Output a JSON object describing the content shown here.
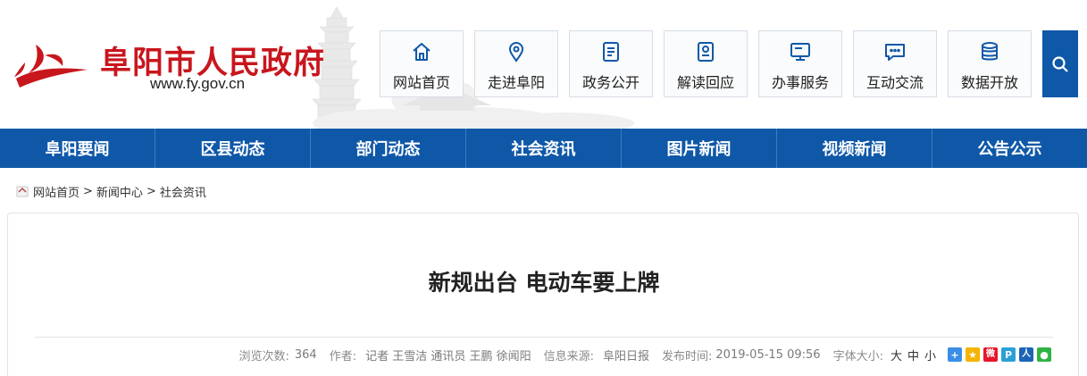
{
  "site": {
    "title": "阜阳市人民政府",
    "url": "www.fy.gov.cn"
  },
  "quick_nav": [
    {
      "label": "网站首页",
      "icon": "home-icon"
    },
    {
      "label": "走进阜阳",
      "icon": "location-pin-icon"
    },
    {
      "label": "政务公开",
      "icon": "document-icon"
    },
    {
      "label": "解读回应",
      "icon": "badge-document-icon"
    },
    {
      "label": "办事服务",
      "icon": "monitor-icon"
    },
    {
      "label": "互动交流",
      "icon": "chat-bubble-icon"
    },
    {
      "label": "数据开放",
      "icon": "database-icon"
    }
  ],
  "search": {
    "icon": "search-icon"
  },
  "main_nav": [
    "阜阳要闻",
    "区县动态",
    "部门动态",
    "社会资讯",
    "图片新闻",
    "视频新闻",
    "公告公示"
  ],
  "breadcrumb": {
    "items": [
      "网站首页",
      "新闻中心",
      "社会资讯"
    ],
    "separator": ">"
  },
  "article": {
    "title": "新规出台 电动车要上牌",
    "meta": {
      "views_label": "浏览次数:",
      "views": "364",
      "author_label": "作者:",
      "author": "记者 王雪洁 通讯员 王鹏 徐闻阳",
      "source_label": "信息来源:",
      "source": "阜阳日报",
      "date_label": "发布时间:",
      "date": "2019-05-15 09:56",
      "fontsize_label": "字体大小:",
      "fontsizes": [
        "大",
        "中",
        "小"
      ]
    },
    "share": [
      {
        "icon": "share-plus-icon",
        "color": "#3a8ee6",
        "glyph": "+"
      },
      {
        "icon": "qzone-icon",
        "color": "#f5b400",
        "glyph": "★"
      },
      {
        "icon": "weibo-icon",
        "color": "#e6162d",
        "glyph": "微"
      },
      {
        "icon": "tencent-weibo-icon",
        "color": "#2a9fd6",
        "glyph": "P"
      },
      {
        "icon": "renren-icon",
        "color": "#1b64b6",
        "glyph": "人"
      },
      {
        "icon": "wechat-icon",
        "color": "#2fb344",
        "glyph": "●"
      }
    ]
  },
  "colors": {
    "brand_red": "#c8161d",
    "nav_blue": "#0f58a8"
  }
}
